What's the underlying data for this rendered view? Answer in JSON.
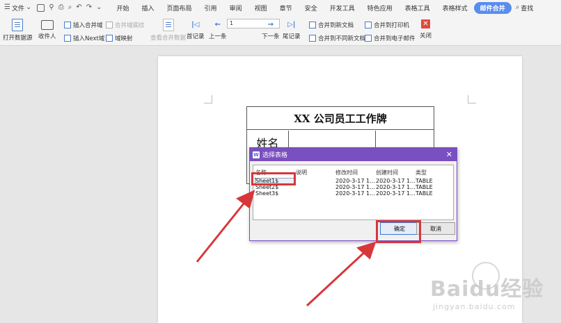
{
  "menubar": {
    "file_label": "文件",
    "tabs": [
      "开始",
      "插入",
      "页面布局",
      "引用",
      "审阅",
      "视图",
      "章节",
      "安全",
      "开发工具",
      "特色应用",
      "表格工具",
      "表格样式",
      "邮件合并"
    ],
    "active_tab": "邮件合并",
    "search_label": "查找"
  },
  "ribbon": {
    "open_source": "打开数据源",
    "recipients": "收件人",
    "insert_merge_field": "插入合并域",
    "merge_field_shading": "合并域底纹",
    "insert_next_field": "插入Next域",
    "field_mapping": "域映射",
    "view_merged_data": "查看合并数据",
    "first_record": "首记录",
    "previous": "上一条",
    "record_number": "1",
    "next": "下一条",
    "last_record": "尾记录",
    "merge_to_new_doc": "合并到新文档",
    "merge_to_different_docs": "合并到不同新文档",
    "merge_to_printer": "合并到打印机",
    "merge_to_email": "合并到电子邮件",
    "close": "关闭"
  },
  "document": {
    "table_title": "XX 公司员工工作牌",
    "name_label": "姓名"
  },
  "dialog": {
    "title": "选择表格",
    "columns": [
      "名称",
      "说明",
      "修改时间",
      "创建时间",
      "类型"
    ],
    "rows": [
      {
        "name": "Sheet1$",
        "desc": "",
        "modified": "2020-3-17 1...",
        "created": "2020-3-17 1...",
        "type": "TABLE"
      },
      {
        "name": "Sheet2$",
        "desc": "",
        "modified": "2020-3-17 1...",
        "created": "2020-3-17 1...",
        "type": "TABLE"
      },
      {
        "name": "Sheet3$",
        "desc": "",
        "modified": "2020-3-17 1...",
        "created": "2020-3-17 1...",
        "type": "TABLE"
      }
    ],
    "ok_label": "确定",
    "cancel_label": "取消"
  },
  "watermark": {
    "logo": "Baidu经验",
    "url": "jingyan.baidu.com"
  },
  "colors": {
    "accent": "#5a8dee",
    "dialog_title": "#7a4fc0",
    "highlight": "#d8363a",
    "close_red": "#e2483d"
  }
}
